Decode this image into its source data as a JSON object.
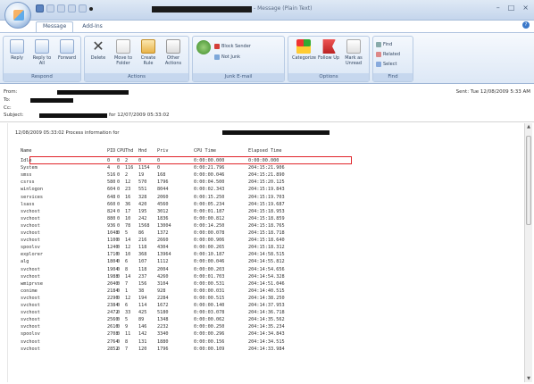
{
  "window": {
    "title_text": "- Message (Plain Text)",
    "minimize": "–",
    "maximize": "□",
    "close": "×"
  },
  "ribbon": {
    "tabs": [
      "Message",
      "Add-Ins"
    ],
    "groups": [
      {
        "label": "Respond",
        "buttons": [
          "Reply",
          "Reply to All",
          "Forward"
        ]
      },
      {
        "label": "Actions",
        "buttons": [
          "Delete",
          "Move to Folder",
          "Create Rule",
          "Other Actions"
        ]
      },
      {
        "label": "Junk E-mail",
        "buttons": [
          "Block Sender",
          "Not Junk"
        ]
      },
      {
        "label": "Options",
        "buttons": [
          "Categorize",
          "Follow Up",
          "Mark as Unread"
        ]
      },
      {
        "label": "Find",
        "buttons": [
          "Find",
          "Related",
          "Select"
        ]
      }
    ]
  },
  "header": {
    "from_label": "From:",
    "to_label": "To:",
    "cc_label": "Cc:",
    "subject_label": "Subject:",
    "subject_suffix": "for 12/07/2009 05:33:02",
    "sent_text": "Sent: Tue 12/08/2009 5:33 AM"
  },
  "body": {
    "banner": "12/08/2009 05:33:02 Process information for",
    "columns": [
      "Name",
      "PID",
      "CPU",
      "Thd",
      "Hnd",
      "Priv",
      "CPU Time",
      "Elapsed Time"
    ],
    "rows": [
      [
        "Idle",
        "0",
        "0",
        "2",
        "0",
        "0",
        "0:00:00.000",
        "0:00:00.000"
      ],
      [
        "System",
        "4",
        "0",
        "116",
        "1154",
        "0",
        "0:00:21.796",
        "204:15:21.906"
      ],
      [
        "smss",
        "516",
        "0",
        "2",
        "19",
        "168",
        "0:00:00.046",
        "204:15:21.890"
      ],
      [
        "csrss",
        "580",
        "0",
        "12",
        "570",
        "1796",
        "0:00:04.500",
        "204:15:20.125"
      ],
      [
        "winlogon",
        "604",
        "0",
        "23",
        "551",
        "8044",
        "0:00:02.343",
        "204:15:19.843"
      ],
      [
        "services",
        "648",
        "0",
        "16",
        "328",
        "2060",
        "0:00:15.250",
        "204:15:19.703"
      ],
      [
        "lsass",
        "660",
        "0",
        "36",
        "420",
        "4560",
        "0:00:05.234",
        "204:15:19.687"
      ],
      [
        "svchost",
        "824",
        "0",
        "17",
        "195",
        "3012",
        "0:00:01.187",
        "204:15:18.953"
      ],
      [
        "svchost",
        "880",
        "0",
        "10",
        "242",
        "1836",
        "0:00:00.812",
        "204:15:18.859"
      ],
      [
        "svchost",
        "936",
        "0",
        "78",
        "1568",
        "13004",
        "0:00:14.250",
        "204:15:18.765"
      ],
      [
        "svchost",
        "1048",
        "0",
        "5",
        "86",
        "1372",
        "0:00:00.078",
        "204:15:18.718"
      ],
      [
        "svchost",
        "1100",
        "0",
        "14",
        "216",
        "2660",
        "0:00:00.906",
        "204:15:18.640"
      ],
      [
        "spoolsv",
        "1240",
        "0",
        "12",
        "118",
        "4304",
        "0:00:00.265",
        "204:15:18.312"
      ],
      [
        "explorer",
        "1716",
        "0",
        "10",
        "368",
        "13964",
        "0:00:10.187",
        "204:14:58.515"
      ],
      [
        "alg",
        "1804",
        "0",
        "6",
        "107",
        "1112",
        "0:00:00.046",
        "204:14:55.812"
      ],
      [
        "svchost",
        "1904",
        "0",
        "8",
        "118",
        "2004",
        "0:00:00.203",
        "204:14:54.656"
      ],
      [
        "svchost",
        "1988",
        "0",
        "14",
        "237",
        "4260",
        "0:00:01.703",
        "204:14:54.328"
      ],
      [
        "wmiprvse",
        "2040",
        "0",
        "7",
        "156",
        "3104",
        "0:00:00.531",
        "204:14:51.046"
      ],
      [
        "conime",
        "2184",
        "0",
        "1",
        "38",
        "928",
        "0:00:00.031",
        "204:14:40.515"
      ],
      [
        "svchost",
        "2296",
        "0",
        "12",
        "194",
        "2284",
        "0:00:00.515",
        "204:14:38.250"
      ],
      [
        "svchost",
        "2384",
        "0",
        "6",
        "114",
        "1672",
        "0:00:00.140",
        "204:14:37.953"
      ],
      [
        "svchost",
        "2472",
        "0",
        "33",
        "425",
        "5180",
        "0:00:03.078",
        "204:14:36.718"
      ],
      [
        "svchost",
        "2560",
        "0",
        "5",
        "89",
        "1348",
        "0:00:00.062",
        "204:14:35.562"
      ],
      [
        "svchost",
        "2616",
        "0",
        "9",
        "146",
        "2232",
        "0:00:00.250",
        "204:14:35.234"
      ],
      [
        "spoolsv",
        "2708",
        "0",
        "11",
        "142",
        "3340",
        "0:00:00.296",
        "204:14:34.843"
      ],
      [
        "svchost",
        "2764",
        "0",
        "8",
        "131",
        "1880",
        "0:00:00.156",
        "204:14:34.515"
      ],
      [
        "svchost",
        "2852",
        "0",
        "7",
        "120",
        "1796",
        "0:00:00.109",
        "204:14:33.984"
      ]
    ]
  }
}
